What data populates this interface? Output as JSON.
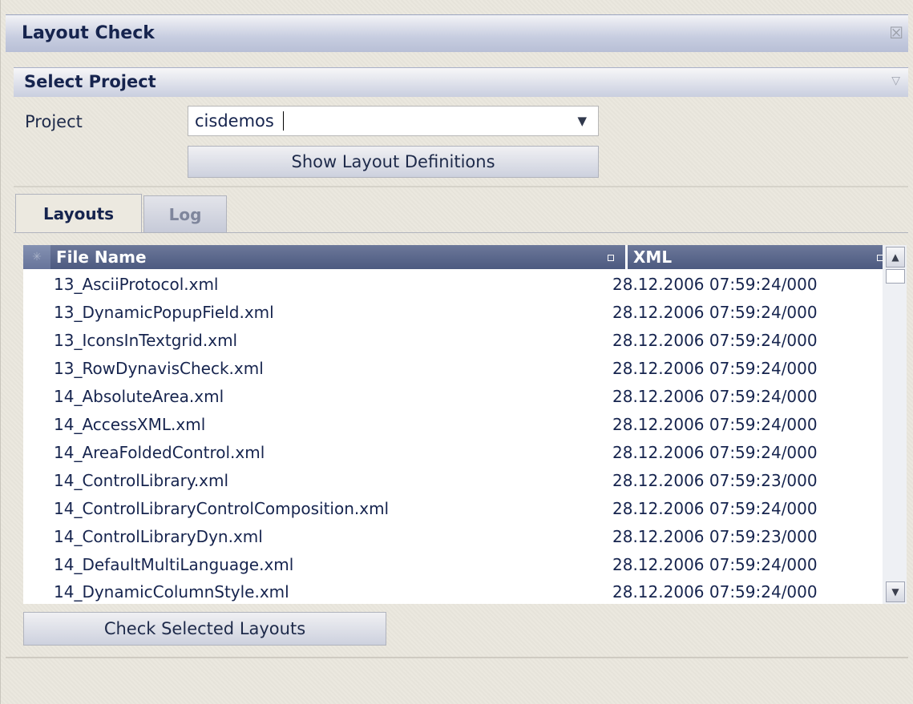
{
  "window": {
    "title": "Layout Check"
  },
  "select_project": {
    "header": "Select Project",
    "project_label": "Project",
    "project_value": "cisdemos",
    "show_button": "Show Layout Definitions"
  },
  "tabs": [
    {
      "label": "Layouts"
    },
    {
      "label": "Log"
    }
  ],
  "grid": {
    "columns": [
      "File Name",
      "XML"
    ],
    "rows": [
      {
        "name": "13_AsciiProtocol.xml",
        "xml": "28.12.2006 07:59:24/000"
      },
      {
        "name": "13_DynamicPopupField.xml",
        "xml": "28.12.2006 07:59:24/000"
      },
      {
        "name": "13_IconsInTextgrid.xml",
        "xml": "28.12.2006 07:59:24/000"
      },
      {
        "name": "13_RowDynavisCheck.xml",
        "xml": "28.12.2006 07:59:24/000"
      },
      {
        "name": "14_AbsoluteArea.xml",
        "xml": "28.12.2006 07:59:24/000"
      },
      {
        "name": "14_AccessXML.xml",
        "xml": "28.12.2006 07:59:24/000"
      },
      {
        "name": "14_AreaFoldedControl.xml",
        "xml": "28.12.2006 07:59:24/000"
      },
      {
        "name": "14_ControlLibrary.xml",
        "xml": "28.12.2006 07:59:23/000"
      },
      {
        "name": "14_ControlLibraryControlComposition.xml",
        "xml": "28.12.2006 07:59:24/000"
      },
      {
        "name": "14_ControlLibraryDyn.xml",
        "xml": "28.12.2006 07:59:23/000"
      },
      {
        "name": "14_DefaultMultiLanguage.xml",
        "xml": "28.12.2006 07:59:24/000"
      },
      {
        "name": "14_DynamicColumnStyle.xml",
        "xml": "28.12.2006 07:59:24/000"
      }
    ]
  },
  "check_button": "Check Selected Layouts",
  "icons": {
    "close": "close-icon",
    "collapse": "collapse-icon",
    "dropdown": "dropdown-arrow-icon",
    "select_all": "select-all-icon",
    "sort": "sort-icon",
    "scroll_up": "scroll-up-icon",
    "scroll_down": "scroll-down-icon"
  }
}
